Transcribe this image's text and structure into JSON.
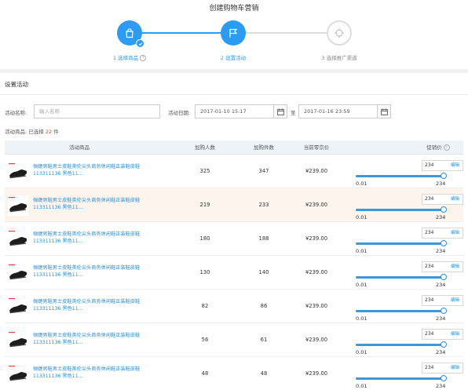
{
  "page": {
    "title": "创建购物车营销"
  },
  "steps": [
    {
      "label": "1 选择商品",
      "state": "done",
      "icon": "shopping-bag-icon"
    },
    {
      "label": "2 设置活动",
      "state": "active",
      "icon": "flag-icon"
    },
    {
      "label": "3 选择推广渠道",
      "state": "inactive",
      "icon": "target-icon"
    }
  ],
  "section": {
    "title": "设置活动"
  },
  "form": {
    "name_label": "活动名称:",
    "name_placeholder": "输入名称",
    "date_label": "活动日期:",
    "start_date": "2017-01-10 15:17",
    "date_separator": "至",
    "end_date": "2017-01-16 23:59"
  },
  "selection": {
    "prefix": "活动商品: 已选择 ",
    "count": "22",
    "suffix": " 件"
  },
  "table": {
    "headers": {
      "product": "活动商品",
      "buyers": "加购人数",
      "items": "加购件数",
      "price": "当前零京价",
      "promo": "促销价"
    },
    "edit_label": "编辑",
    "rows": [
      {
        "name": "俪婕男鞋男士皮鞋英伦尖头商务休闲鞋正装鞋皮鞋 113311136 黑色11...",
        "buyers": "325",
        "items": "347",
        "price": "¥239.00",
        "promo": "234",
        "min": "0.01",
        "max": "234",
        "highlight": false
      },
      {
        "name": "俪婕男鞋男士皮鞋英伦尖头商务休闲鞋正装鞋皮鞋 113311136 黑色11...",
        "buyers": "219",
        "items": "233",
        "price": "¥239.00",
        "promo": "234",
        "min": "0.01",
        "max": "234",
        "highlight": true
      },
      {
        "name": "俪婕男鞋男士皮鞋英伦尖头商务休闲鞋正装鞋皮鞋 113311136 黑色11...",
        "buyers": "180",
        "items": "188",
        "price": "¥239.00",
        "promo": "234",
        "min": "0.01",
        "max": "234",
        "highlight": false
      },
      {
        "name": "俪婕男鞋男士皮鞋英伦尖头商务休闲鞋正装鞋皮鞋 113311136 黑色11...",
        "buyers": "130",
        "items": "140",
        "price": "¥239.00",
        "promo": "234",
        "min": "0.01",
        "max": "234",
        "highlight": false
      },
      {
        "name": "俪婕男鞋男士皮鞋英伦尖头商务休闲鞋正装鞋皮鞋 113311136 黑色11...",
        "buyers": "82",
        "items": "86",
        "price": "¥239.00",
        "promo": "234",
        "min": "0.01",
        "max": "234",
        "highlight": false
      },
      {
        "name": "俪婕男鞋男士皮鞋英伦尖头商务休闲鞋正装鞋皮鞋 113311136 黑色11...",
        "buyers": "56",
        "items": "61",
        "price": "¥239.00",
        "promo": "234",
        "min": "0.01",
        "max": "234",
        "highlight": false
      },
      {
        "name": "俪婕男鞋男士皮鞋英伦尖头商务休闲鞋正装鞋皮鞋 113311136 黑色11...",
        "buyers": "48",
        "items": "48",
        "price": "¥239.00",
        "promo": "234",
        "min": "0.01",
        "max": "234",
        "highlight": false
      }
    ]
  },
  "colors": {
    "accent": "#2b9cf2",
    "link": "#2b8fd9",
    "count": "#e0443b",
    "highlight_row": "#fdf4ee"
  }
}
